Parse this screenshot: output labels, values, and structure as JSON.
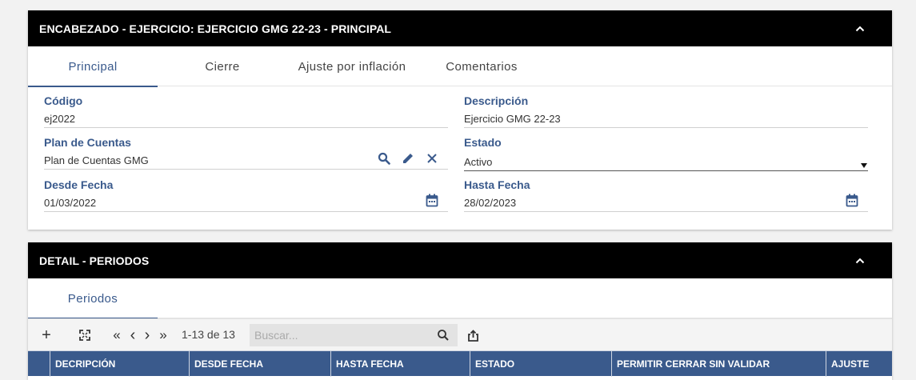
{
  "header_panel": {
    "title": "ENCABEZADO - EJERCICIO: EJERCICIO GMG 22-23 - PRINCIPAL",
    "tabs": [
      "Principal",
      "Cierre",
      "Ajuste por inflación",
      "Comentarios"
    ],
    "fields": {
      "codigo": {
        "label": "Código",
        "value": "ej2022"
      },
      "descripcion": {
        "label": "Descripción",
        "value": "Ejercicio GMG 22-23"
      },
      "plan": {
        "label": "Plan de Cuentas",
        "value": "Plan de Cuentas GMG"
      },
      "estado": {
        "label": "Estado",
        "value": "Activo"
      },
      "desde": {
        "label": "Desde Fecha",
        "value": "01/03/2022"
      },
      "hasta": {
        "label": "Hasta Fecha",
        "value": "28/02/2023"
      }
    }
  },
  "detail_panel": {
    "title": "DETAIL - PERIODOS",
    "tabs": [
      "Periodos"
    ],
    "toolbar": {
      "add_label": "+",
      "first_label": "«",
      "prev_label": "‹",
      "next_label": "›",
      "last_label": "»",
      "page_info": "1-13 de 13",
      "search_placeholder": "Buscar..."
    },
    "columns": [
      "DECRIPCIÓN",
      "DESDE FECHA",
      "HASTA FECHA",
      "ESTADO",
      "PERMITIR CERRAR SIN VALIDAR",
      "AJUSTE"
    ]
  },
  "colors": {
    "accent": "#3a5a8c",
    "panel_bar": "#000000",
    "background": "#f2f2f2"
  },
  "icons": {
    "collapse": "chevron-up-icon",
    "search": "magnifier-icon",
    "edit": "pencil-icon",
    "clear": "close-icon",
    "calendar": "calendar-icon",
    "dropdown": "triangle-down-icon",
    "expand": "fullscreen-icon",
    "export": "share-icon"
  }
}
